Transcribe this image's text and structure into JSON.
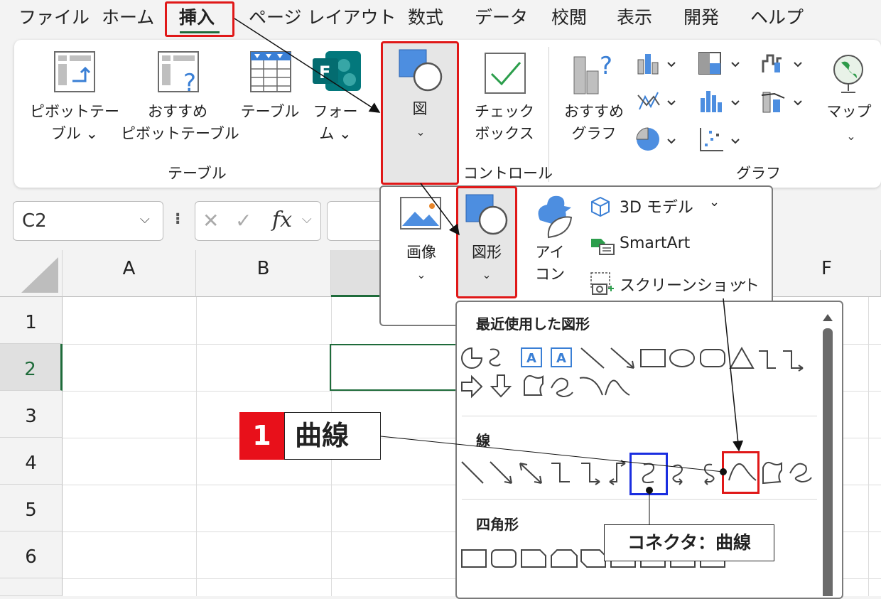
{
  "menu": {
    "items": [
      "ファイル",
      "ホーム",
      "挿入",
      "ページ レイアウト",
      "数式",
      "データ",
      "校閲",
      "表示",
      "開発",
      "ヘルプ"
    ],
    "active": "挿入"
  },
  "ribbon": {
    "pivot_l1": "ピボットテー",
    "pivot_l2": "ブル ⌄",
    "recpivot_l1": "おすすめ",
    "recpivot_l2": "ピボットテーブル",
    "table": "テーブル",
    "forms_l1": "フォー",
    "forms_l2": "ム ⌄",
    "figure": "図",
    "checkbox_l1": "チェック",
    "checkbox_l2": "ボックス",
    "recchart_l1": "おすすめ",
    "recchart_l2": "グラフ",
    "map": "マップ",
    "group_table": "テーブル",
    "group_controls": "コントロール",
    "group_chart": "グラフ"
  },
  "formula_bar": {
    "name_box": "C2",
    "cancel_symbol": "✕",
    "enter_symbol": "✓",
    "fx": "fx"
  },
  "sheet": {
    "columns": [
      "A",
      "B",
      "F"
    ],
    "rows": [
      "1",
      "2",
      "3",
      "4",
      "5",
      "6"
    ],
    "active_cell": "C2"
  },
  "figure_menu": {
    "image_l1": "画像",
    "shapes_l1": "図形",
    "icons_l1": "アイ",
    "icons_l2": "コン",
    "model3d": "3D モデル",
    "smartart": "SmartArt",
    "screenshot": "スクリーンショット"
  },
  "shapes_gallery": {
    "recent_title": "最近使用した図形",
    "lines_title": "線",
    "rect_title": "四角形"
  },
  "callouts": {
    "step_number": "1",
    "step_label": "曲線",
    "connector_label": "コネクタ：曲線"
  },
  "colors": {
    "accent_red": "#e01818",
    "accent_blue": "#1a2ee0",
    "excel_green": "#1e6b3a",
    "icon_blue": "#4d8ee0"
  }
}
